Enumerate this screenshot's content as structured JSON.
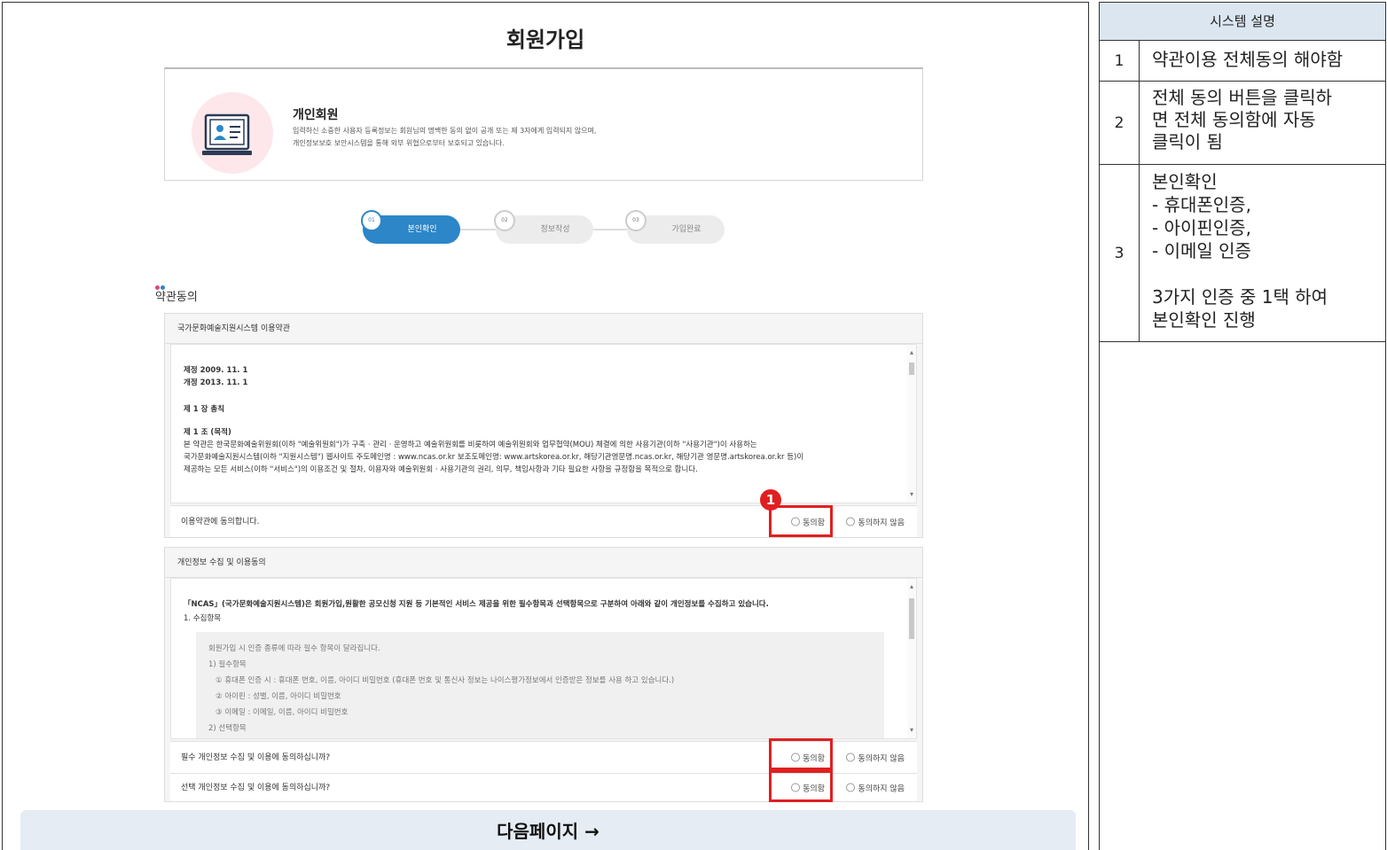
{
  "page": {
    "title": "회원가입",
    "member_card": {
      "title": "개인회원",
      "desc_line1": "입력하신 소중한 사용자 등록정보는 회원님의 명백한 동의 없이 공개 또는 제 3자에게 입력되지 않으며,",
      "desc_line2": "개인정보보호 보안시스템을 통해 외부 위협으로부터 보호되고 있습니다."
    },
    "steps": [
      {
        "num": "01",
        "label": "본인확인",
        "active": true
      },
      {
        "num": "02",
        "label": "정보작성",
        "active": false
      },
      {
        "num": "03",
        "label": "가입완료",
        "active": false
      }
    ],
    "section_title": "약관동의",
    "dot_colors": [
      "#e0457b",
      "#2c86c8"
    ],
    "terms1": {
      "title": "국가문화예술지원시스템 이용약관",
      "lines": [
        "제정 2009. 11. 1",
        "개정 2013. 11. 1",
        "제 1 장 총칙",
        "제 1 조 (목적)",
        "본 약관은 한국문화예술위원회(이하 \"예술위원회\")가 구축 · 관리 · 운영하고 예술위원회를 비롯하여 예술위원회와 업무협약(MOU) 체결에 의한 사용기관(이하 \"사용기관\")이 사용하는",
        "국가문화예술지원시스템(이하 \"지원시스템\") 웹사이트 주도메인명 : www.ncas.or.kr 보조도메인명: www.artskorea.or.kr, 해당기관영문명.ncas.or.kr, 해당기관 영문명.artskorea.or.kr 등)이",
        "제공하는 모든 서비스(이하 \"서비스\")의 이용조건 및 절차, 이용자와 예술위원회 · 사용기관의 권리, 의무, 책임사항과 기타 필요한 사항을 규정함을 목적으로 합니다."
      ],
      "question": "이용약관에 동의합니다.",
      "agree": "동의함",
      "disagree": "동의하지 않음"
    },
    "terms2": {
      "title": "개인정보 수집 및 이용동의",
      "intro": "「NCAS」(국가문화예술지원시스템)은 회원가입,원활한 공모신청 지원 등 기본적인 서비스 제공을 위한 필수항목과 선택항목으로 구분하여 아래와 같이 개인정보를 수집하고 있습니다.",
      "sub": "1. 수집항목",
      "inner_lines": [
        "회원가입 시 인증 종류에 따라 필수 항목이 달라집니다.",
        "1) 필수항목",
        "① 휴대폰 인증 시 : 휴대폰 번호, 이름, 아이디 비밀번호 (휴대폰 번호 및 통신사 정보는 나이스평가정보에서 인증받은 정보를 사용 하고 있습니다.)",
        "② 아이핀 : 성별, 이름, 아이디 비밀번호",
        "③ 이메일 : 이메일, 이름, 아이디 비밀번호",
        "2) 선택항목"
      ],
      "q_required": "필수 개인정보 수집 및 이용에 동의하십니까?",
      "q_optional": "선택 개인정보 수집 및 이용에 동의하십니까?",
      "agree": "동의함",
      "disagree": "동의하지 않음"
    },
    "marker": "1",
    "next_button": "다음페이지 →"
  },
  "side": {
    "header": "시스템 설명",
    "rows": [
      {
        "num": "1",
        "desc": "약관이용 전체동의 해야함"
      },
      {
        "num": "2",
        "desc": "전체 동의 버튼을 클릭하\n면 전체 동의함에 자동\n클릭이 됨"
      },
      {
        "num": "3",
        "desc": "본인확인\n -  휴대폰인증,\n -  아이핀인증,\n -  이메일 인증\n\n3가지 인증 중 1택 하여\n본인확인 진행"
      }
    ]
  },
  "colors": {
    "accent": "#2c86c8",
    "highlight": "#e02020",
    "side_header_bg": "#dbe6f1",
    "next_bar_bg": "#e6ecf3"
  }
}
